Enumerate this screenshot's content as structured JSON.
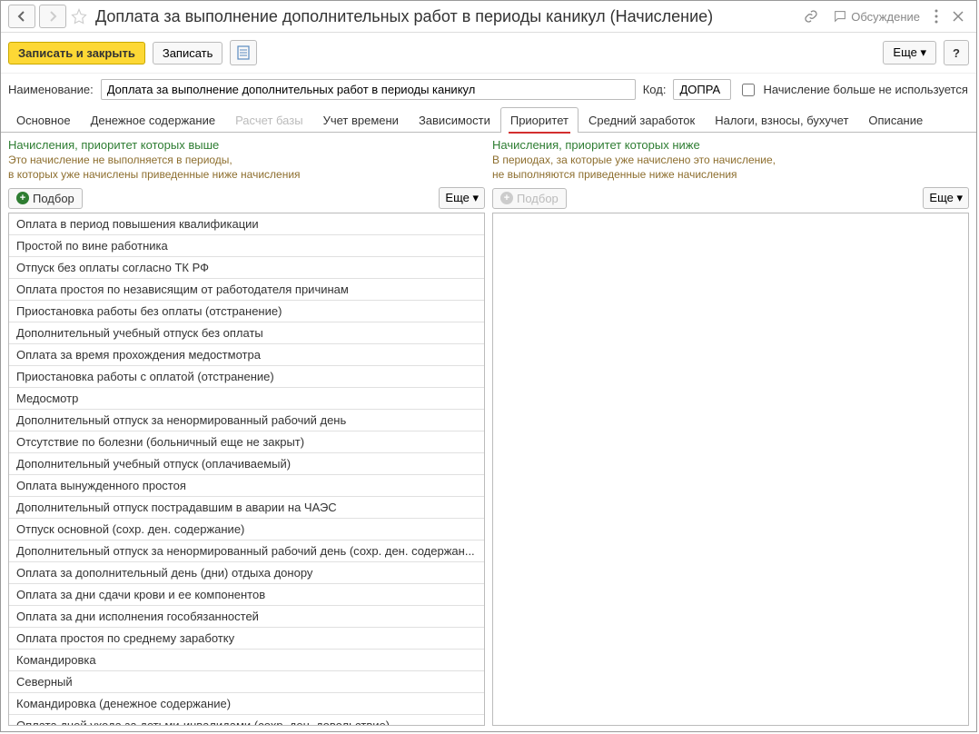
{
  "header": {
    "title": "Доплата за выполнение дополнительных работ в периоды каникул (Начисление)",
    "discussion": "Обсуждение"
  },
  "commands": {
    "save_close": "Записать и закрыть",
    "save": "Записать",
    "more": "Еще",
    "help": "?"
  },
  "form": {
    "name_label": "Наименование:",
    "name_value": "Доплата за выполнение дополнительных работ в периоды каникул",
    "code_label": "Код:",
    "code_value": "ДОПРА",
    "discontinued_label": "Начисление больше не используется"
  },
  "tabs": [
    "Основное",
    "Денежное содержание",
    "Расчет базы",
    "Учет времени",
    "Зависимости",
    "Приоритет",
    "Средний заработок",
    "Налоги, взносы, бухучет",
    "Описание"
  ],
  "left": {
    "title": "Начисления, приоритет которых выше",
    "desc1": "Это начисление не выполняется в периоды,",
    "desc2": "в которых уже начислены приведенные ниже начисления",
    "select": "Подбор",
    "more": "Еще",
    "items": [
      "Оплата в период повышения квалификации",
      "Простой по вине работника",
      "Отпуск без оплаты согласно ТК РФ",
      "Оплата простоя по независящим от работодателя причинам",
      "Приостановка работы без оплаты (отстранение)",
      "Дополнительный учебный отпуск без оплаты",
      "Оплата за время прохождения медостмотра",
      "Приостановка работы с оплатой (отстранение)",
      "Медосмотр",
      "Дополнительный отпуск за ненормированный рабочий день",
      "Отсутствие по болезни (больничный еще не закрыт)",
      "Дополнительный учебный отпуск (оплачиваемый)",
      "Оплата вынужденного простоя",
      "Дополнительный отпуск пострадавшим в аварии на ЧАЭС",
      "Отпуск основной (сохр. ден. содержание)",
      "Дополнительный отпуск за ненормированный рабочий день (сохр. ден. содержан...",
      "Оплата за дополнительный день (дни) отдыха донору",
      "Оплата за дни сдачи крови и ее компонентов",
      "Оплата за дни исполнения гособязанностей",
      "Оплата простоя по среднему заработку",
      "Командировка",
      "Северный",
      "Командировка (денежное содержание)",
      "Оплата дней ухода за детьми-инвалидами (сохр. ден. довольствие)"
    ]
  },
  "right": {
    "title": "Начисления, приоритет которых ниже",
    "desc1": "В периодах, за которые уже начислено это начисление,",
    "desc2": "не выполняются приведенные ниже начисления",
    "select": "Подбор",
    "more": "Еще"
  }
}
